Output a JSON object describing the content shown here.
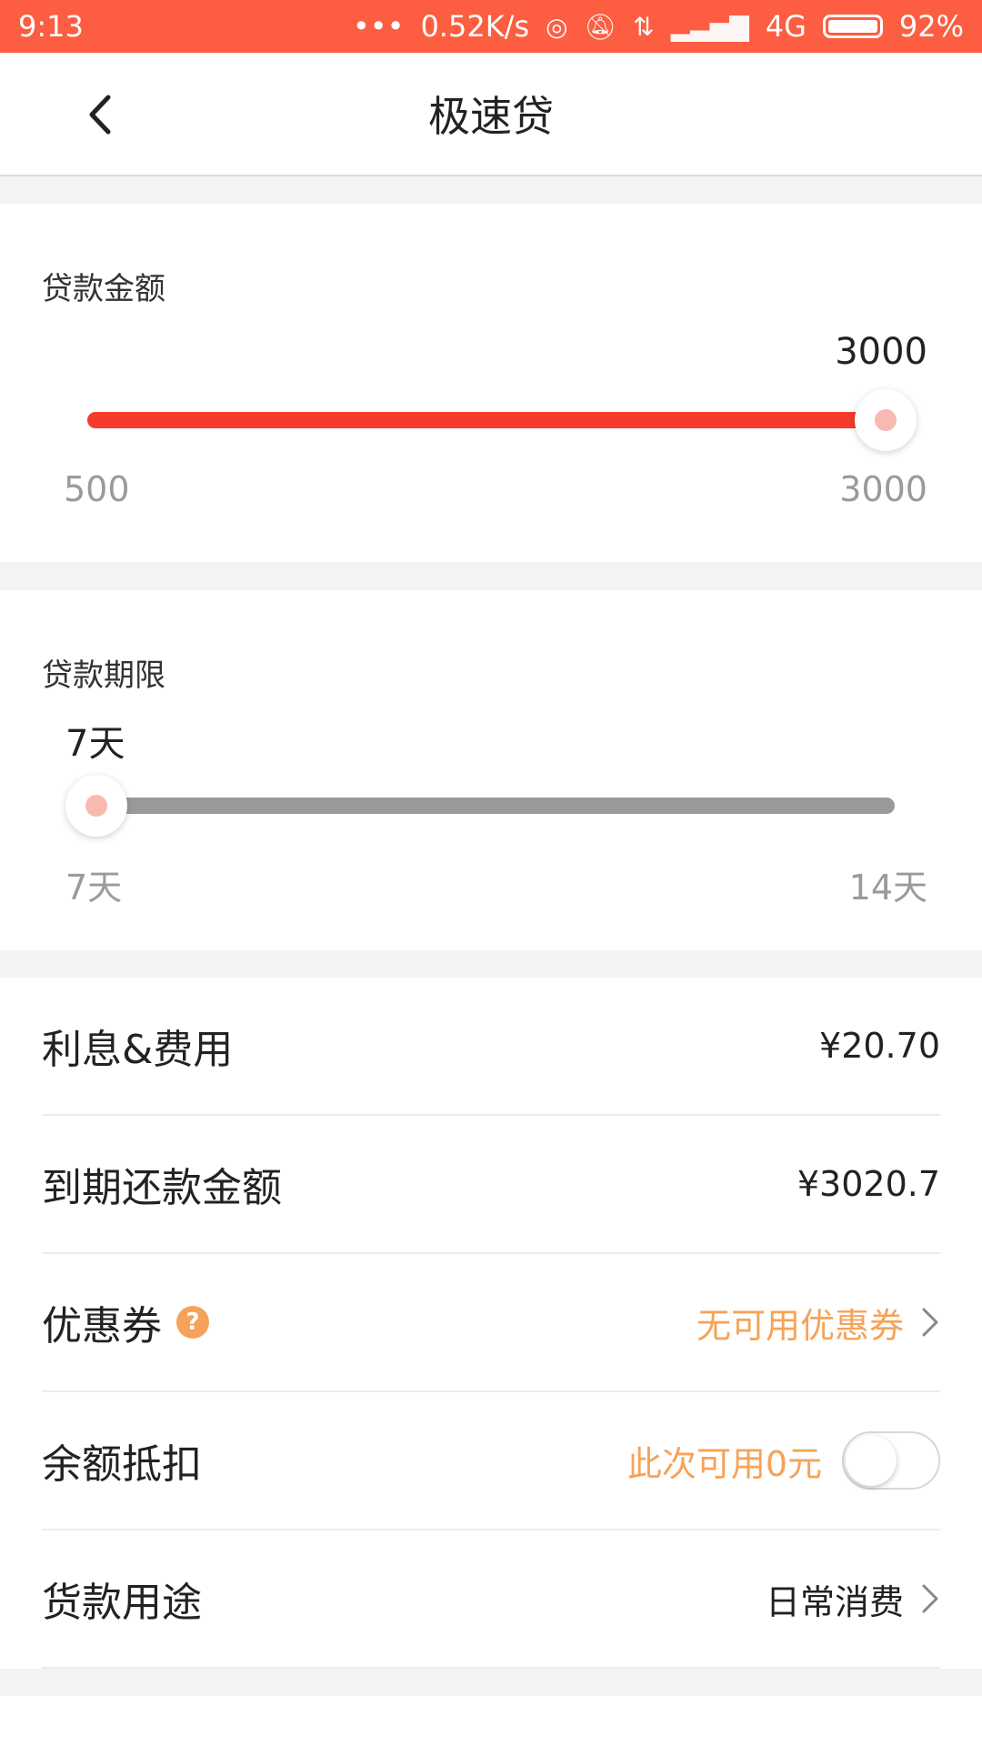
{
  "status_bar": {
    "time": "9:13",
    "dots": "•••",
    "net_speed": "0.52K/s",
    "network": "4G",
    "battery": "92%",
    "bg_color": "#fd5d40"
  },
  "header": {
    "title": "极速贷"
  },
  "amount": {
    "label": "贷款金额",
    "value": "3000",
    "min_label": "500",
    "max_label": "3000",
    "min": 500,
    "max": 3000,
    "current": 3000,
    "active_color": "#f53b2d"
  },
  "term": {
    "label": "贷款期限",
    "value": "7天",
    "min_label": "7天",
    "max_label": "14天",
    "min": 7,
    "max": 14,
    "current": 7,
    "inactive_color": "#999999"
  },
  "list": {
    "interest": {
      "label": "利息&费用",
      "value": "¥20.70"
    },
    "repay": {
      "label": "到期还款金额",
      "value": "¥3020.7"
    },
    "coupon": {
      "label": "优惠券",
      "help": "?",
      "value": "无可用优惠券"
    },
    "balance": {
      "label": "余额抵扣",
      "value": "此次可用0元",
      "toggle_on": false
    },
    "purpose": {
      "label": "货款用途",
      "value": "日常消费"
    }
  }
}
